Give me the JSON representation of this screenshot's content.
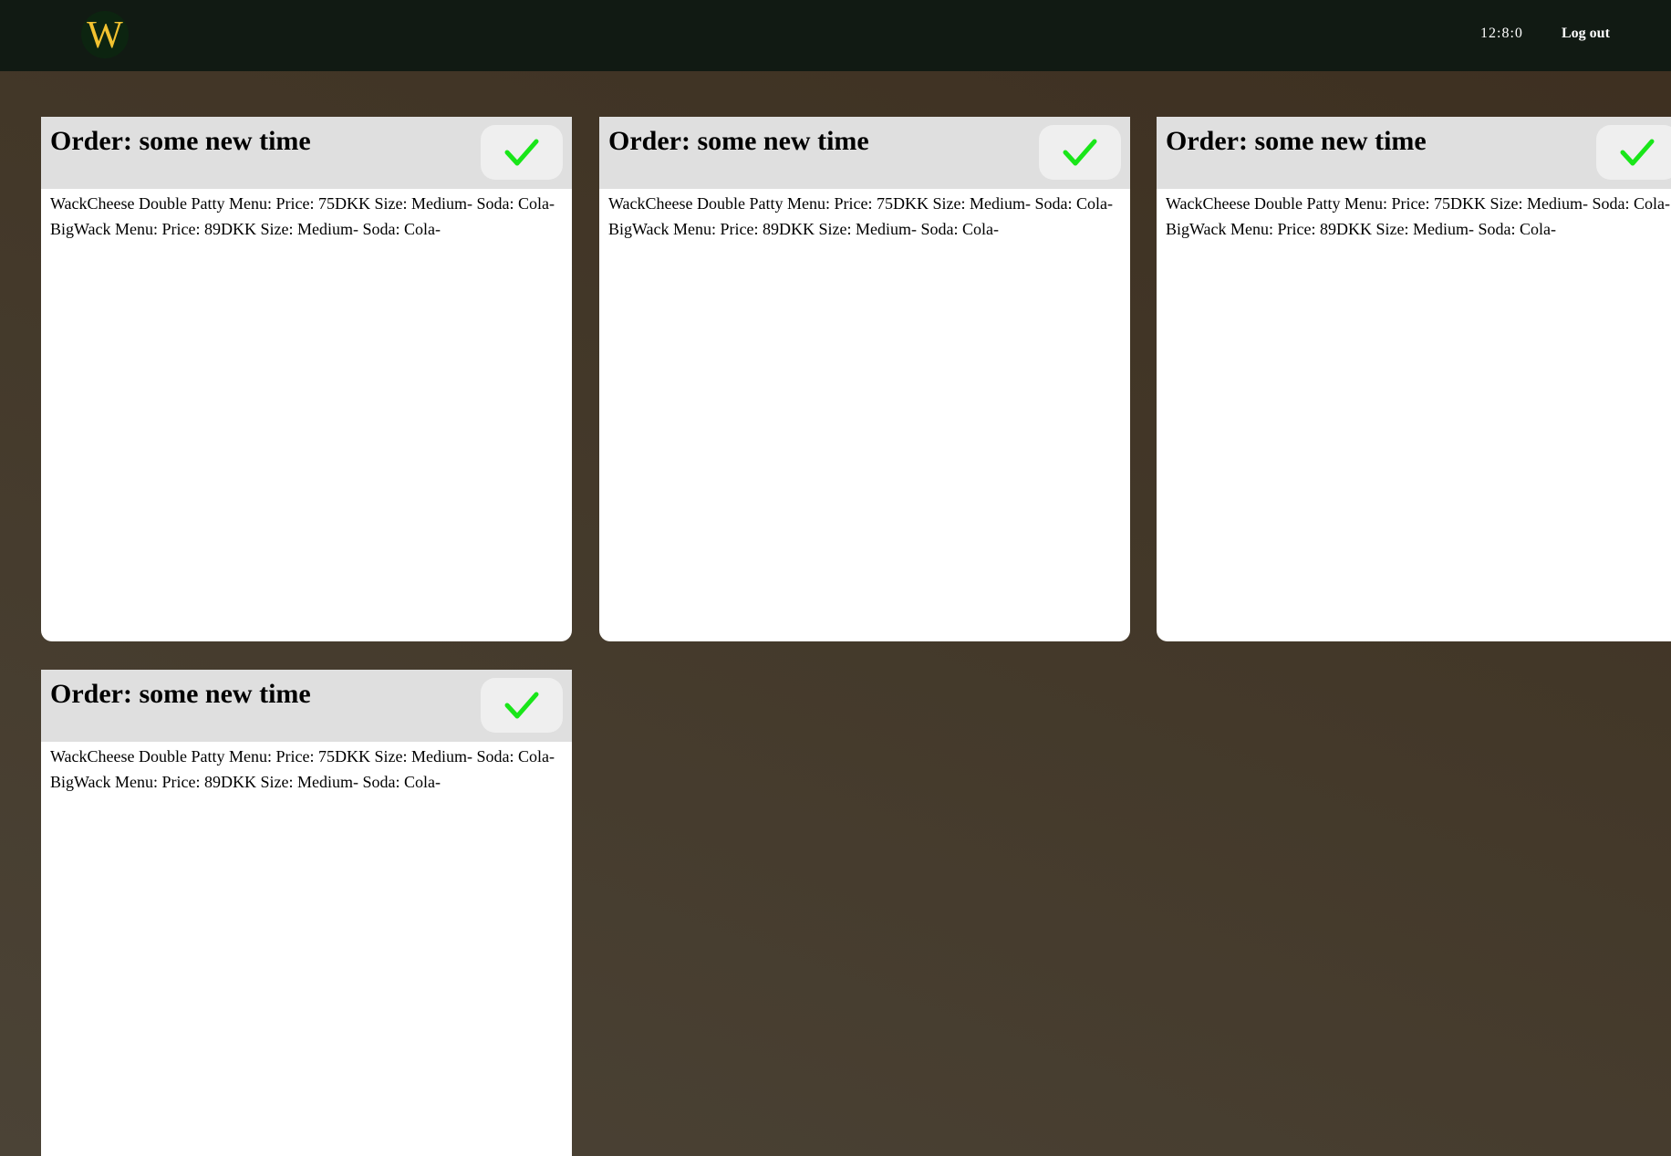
{
  "header": {
    "logo_letter": "W",
    "clock": "12:8:0",
    "logout_label": "Log out"
  },
  "orders": [
    {
      "title": "Order: some new time",
      "items": [
        "WackCheese Double Patty Menu: Price: 75DKK Size: Medium- Soda: Cola-",
        "BigWack Menu: Price: 89DKK Size: Medium- Soda: Cola-"
      ]
    },
    {
      "title": "Order: some new time",
      "items": [
        "WackCheese Double Patty Menu: Price: 75DKK Size: Medium- Soda: Cola-",
        "BigWack Menu: Price: 89DKK Size: Medium- Soda: Cola-"
      ]
    },
    {
      "title": "Order: some new time",
      "items": [
        "WackCheese Double Patty Menu: Price: 75DKK Size: Medium- Soda: Cola-",
        "BigWack Menu: Price: 89DKK Size: Medium- Soda: Cola-"
      ]
    },
    {
      "title": "Order: some new time",
      "items": [
        "WackCheese Double Patty Menu: Price: 75DKK Size: Medium- Soda: Cola-",
        "BigWack Menu: Price: 89DKK Size: Medium- Soda: Cola-"
      ]
    }
  ],
  "icons": {
    "done": "checkmark-icon"
  },
  "colors": {
    "header_bg": "#111a13",
    "logo_letter": "#f2c230",
    "checkmark": "#19e619",
    "card_head_bg": "#dfdfdf"
  }
}
